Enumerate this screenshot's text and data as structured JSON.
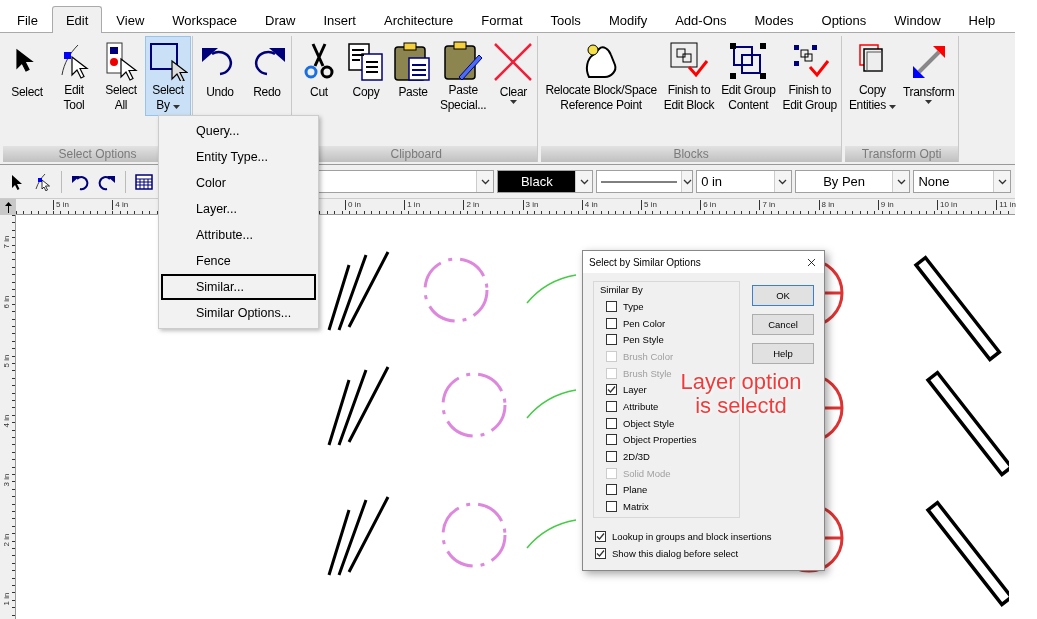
{
  "menu_bar": [
    {
      "label": "File",
      "selected": false
    },
    {
      "label": "Edit",
      "selected": true
    },
    {
      "label": "View",
      "selected": false
    },
    {
      "label": "Workspace",
      "selected": false
    },
    {
      "label": "Draw",
      "selected": false
    },
    {
      "label": "Insert",
      "selected": false
    },
    {
      "label": "Architecture",
      "selected": false
    },
    {
      "label": "Format",
      "selected": false
    },
    {
      "label": "Tools",
      "selected": false
    },
    {
      "label": "Modify",
      "selected": false
    },
    {
      "label": "Add-Ons",
      "selected": false
    },
    {
      "label": "Modes",
      "selected": false
    },
    {
      "label": "Options",
      "selected": false
    },
    {
      "label": "Window",
      "selected": false
    },
    {
      "label": "Help",
      "selected": false
    }
  ],
  "ribbon": {
    "groups": [
      {
        "label": "Select Options",
        "buttons": [
          {
            "kind": "select",
            "lines": [
              "Select"
            ],
            "dropdown": false,
            "selected": false
          },
          {
            "kind": "edit-tool",
            "lines": [
              "Edit",
              "Tool"
            ],
            "dropdown": false,
            "selected": false
          },
          {
            "kind": "select-all",
            "lines": [
              "Select",
              "All"
            ],
            "dropdown": false,
            "selected": false
          },
          {
            "kind": "select-by",
            "lines": [
              "Select",
              "By"
            ],
            "dropdown": true,
            "selected": true
          }
        ]
      },
      {
        "buttons": [
          {
            "kind": "undo",
            "lines": [
              "Undo"
            ],
            "dropdown": false,
            "selected": false
          },
          {
            "kind": "redo",
            "lines": [
              "Redo"
            ],
            "dropdown": false,
            "selected": false
          }
        ]
      },
      {
        "label": "Clipboard",
        "buttons": [
          {
            "kind": "cut",
            "lines": [
              "Cut"
            ],
            "dropdown": false,
            "selected": false
          },
          {
            "kind": "copy",
            "lines": [
              "Copy"
            ],
            "dropdown": false,
            "selected": false
          },
          {
            "kind": "paste",
            "lines": [
              "Paste"
            ],
            "dropdown": false,
            "selected": false
          },
          {
            "kind": "paste-special",
            "lines": [
              "Paste",
              "Special..."
            ],
            "dropdown": false,
            "selected": false
          },
          {
            "kind": "clear",
            "lines": [
              "Clear"
            ],
            "dropdown": true,
            "selected": false
          }
        ]
      },
      {
        "label": "Blocks",
        "buttons": [
          {
            "kind": "relocate",
            "lines": [
              "Relocate Block/Space",
              "Reference Point"
            ],
            "dropdown": false,
            "selected": false
          },
          {
            "kind": "finish-block",
            "lines": [
              "Finish to",
              "Edit Block"
            ],
            "dropdown": false,
            "selected": false
          },
          {
            "kind": "edit-group",
            "lines": [
              "Edit Group",
              "Content"
            ],
            "dropdown": false,
            "selected": false
          },
          {
            "kind": "finish-group",
            "lines": [
              "Finish to",
              "Edit Group"
            ],
            "dropdown": false,
            "selected": false
          }
        ]
      },
      {
        "label": "Transform Opti",
        "buttons": [
          {
            "kind": "copy-entities",
            "lines": [
              "Copy",
              "Entities"
            ],
            "dropdown": true,
            "selected": false
          },
          {
            "kind": "transform",
            "lines": [
              "Transform"
            ],
            "dropdown": true,
            "selected": false
          }
        ]
      }
    ]
  },
  "toolbar": {
    "tools": [
      {
        "kind": "select"
      },
      {
        "kind": "edit-tool"
      },
      {
        "kind": "undo"
      },
      {
        "kind": "redo"
      },
      {
        "kind": "table"
      }
    ],
    "combos": [
      {
        "kind": "plain"
      },
      {
        "kind": "color",
        "value": "Black"
      },
      {
        "kind": "line"
      },
      {
        "kind": "plain",
        "value": "0 in"
      },
      {
        "kind": "centered",
        "value": "By Pen"
      },
      {
        "kind": "plain",
        "value": "None"
      }
    ]
  },
  "ruler": {
    "left_labels": [
      "5 in",
      "4 in"
    ],
    "right_labels": [
      "0 in",
      "1 in",
      "2 in",
      "3 in",
      "4 in",
      "5 in",
      "6 in",
      "7 in",
      "8 in",
      "9 in",
      "10 in",
      "11 in"
    ],
    "vertical_labels": [
      "7 in",
      "6 in",
      "5 in",
      "4 in",
      "3 in",
      "2 in",
      "1 in"
    ]
  },
  "context_menu": {
    "items": [
      {
        "label": "Query...",
        "selected": false
      },
      {
        "label": "Entity Type...",
        "selected": false
      },
      {
        "label": "Color",
        "selected": false
      },
      {
        "label": "Layer...",
        "selected": false
      },
      {
        "label": "Attribute...",
        "selected": false
      },
      {
        "label": "Fence",
        "selected": false
      },
      {
        "label": "Similar...",
        "selected": true
      },
      {
        "label": "Similar Options...",
        "selected": false
      }
    ]
  },
  "dialog": {
    "title": "Select by Similar Options",
    "group_label": "Similar By",
    "options": [
      {
        "label": "Type",
        "checked": false,
        "disabled": false
      },
      {
        "label": "Pen Color",
        "checked": false,
        "disabled": false
      },
      {
        "label": "Pen Style",
        "checked": false,
        "disabled": false
      },
      {
        "label": "Brush Color",
        "checked": false,
        "disabled": true
      },
      {
        "label": "Brush Style",
        "checked": false,
        "disabled": true
      },
      {
        "label": "Layer",
        "checked": true,
        "disabled": false
      },
      {
        "label": "Attribute",
        "checked": false,
        "disabled": false
      },
      {
        "label": "Object Style",
        "checked": false,
        "disabled": false
      },
      {
        "label": "Object Properties",
        "checked": false,
        "disabled": false
      },
      {
        "label": "2D/3D",
        "checked": false,
        "disabled": false
      },
      {
        "label": "Solid Mode",
        "checked": false,
        "disabled": true
      },
      {
        "label": "Plane",
        "checked": false,
        "disabled": false
      },
      {
        "label": "Matrix",
        "checked": false,
        "disabled": false
      }
    ],
    "buttons": [
      {
        "label": "OK",
        "default": true
      },
      {
        "label": "Cancel",
        "default": false
      },
      {
        "label": "Help",
        "default": false
      }
    ],
    "bottom_options": [
      {
        "label": "Lookup in groups and block insertions",
        "checked": true
      },
      {
        "label": "Show this dialog before select",
        "checked": true
      }
    ]
  },
  "annotation": {
    "text": "Layer option is selectd"
  }
}
